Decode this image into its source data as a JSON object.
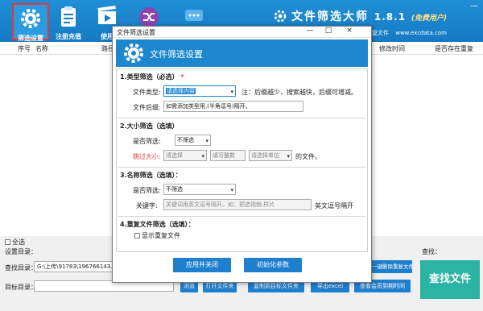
{
  "toolbar": {
    "tools": [
      {
        "label": "筛选设置",
        "icon": "gear-icon"
      },
      {
        "label": "注册充值",
        "icon": "clipboard-icon"
      },
      {
        "label": "使用",
        "icon": "film-icon"
      },
      {
        "label": "",
        "icon": "shuffle-icon"
      },
      {
        "label": "",
        "icon": "chat-icon"
      }
    ],
    "brand_title": "文件筛选大师",
    "brand_version": "1.8.1",
    "brand_tag": "(免费用户)",
    "links": [
      "重复文件",
      "www.excdata.com"
    ],
    "window_controls": [
      "—",
      "□",
      "×"
    ]
  },
  "table": {
    "columns": [
      "序号",
      "名称",
      "路径",
      "修改时间",
      "是否存在重复"
    ]
  },
  "bottom": {
    "select_all": "全选",
    "settings_dir_label": "设置目录：",
    "find_dir_label": "查找目录：",
    "find_dir_value": "G:\\上传\\91783\\196766143.jp",
    "target_dir_label": "目标目录：",
    "target_dir_value": "",
    "browse": "浏览",
    "open_folder": "打开文件夹",
    "copy_to_target": "复制到目标文件夹",
    "export_excel": "导出excel",
    "view_member_expiry": "查看会员到期时间",
    "delete_duplicates": "一键删除重复文件",
    "find_label": "查找：",
    "find_button": "查找文件"
  },
  "dialog": {
    "title": "文件筛选设置",
    "controls": [
      "—",
      "□",
      "×"
    ],
    "banner": "文件筛选设置",
    "sec1": {
      "title": "1.类型筛选（必选）",
      "required_mark": "*",
      "type_label": "文件类型:",
      "type_value": "请选择内容",
      "type_note": "注：后缀越少，搜索越快，后缀可增减。",
      "suffix_label": "文件后缀:",
      "suffix_value": "如需添加类型用,(半角逗号)隔开。"
    },
    "sec2": {
      "title": "2.大小筛选（选填）",
      "filter_label": "是否筛选:",
      "filter_value": "不筛选",
      "skip_label": "跳过大小:",
      "op_value": "请选择",
      "num_placeholder": "填写整数",
      "unit_value": "请选择单位",
      "suffix_text": "的文件。"
    },
    "sec3": {
      "title": "3.名称筛选（选填）：",
      "filter_label": "是否筛选:",
      "filter_value": "不筛选",
      "keyword_label": "关键字:",
      "keyword_placeholder": "关键词用英文逗号隔开。如：预选视频,样片",
      "keyword_note": "英文逗号隔开"
    },
    "sec4": {
      "title": "4.重复文件筛选（选填）：",
      "show_dupes": "显示重复文件"
    },
    "apply_close": "应用并关闭",
    "init_params": "初始化参数"
  },
  "colors": {
    "header_blue": "#1679c4",
    "banner_blue": "#1c86cf",
    "button_blue": "#1f7fcf",
    "find_teal": "#2bb3a4",
    "required_red": "#e53935"
  }
}
